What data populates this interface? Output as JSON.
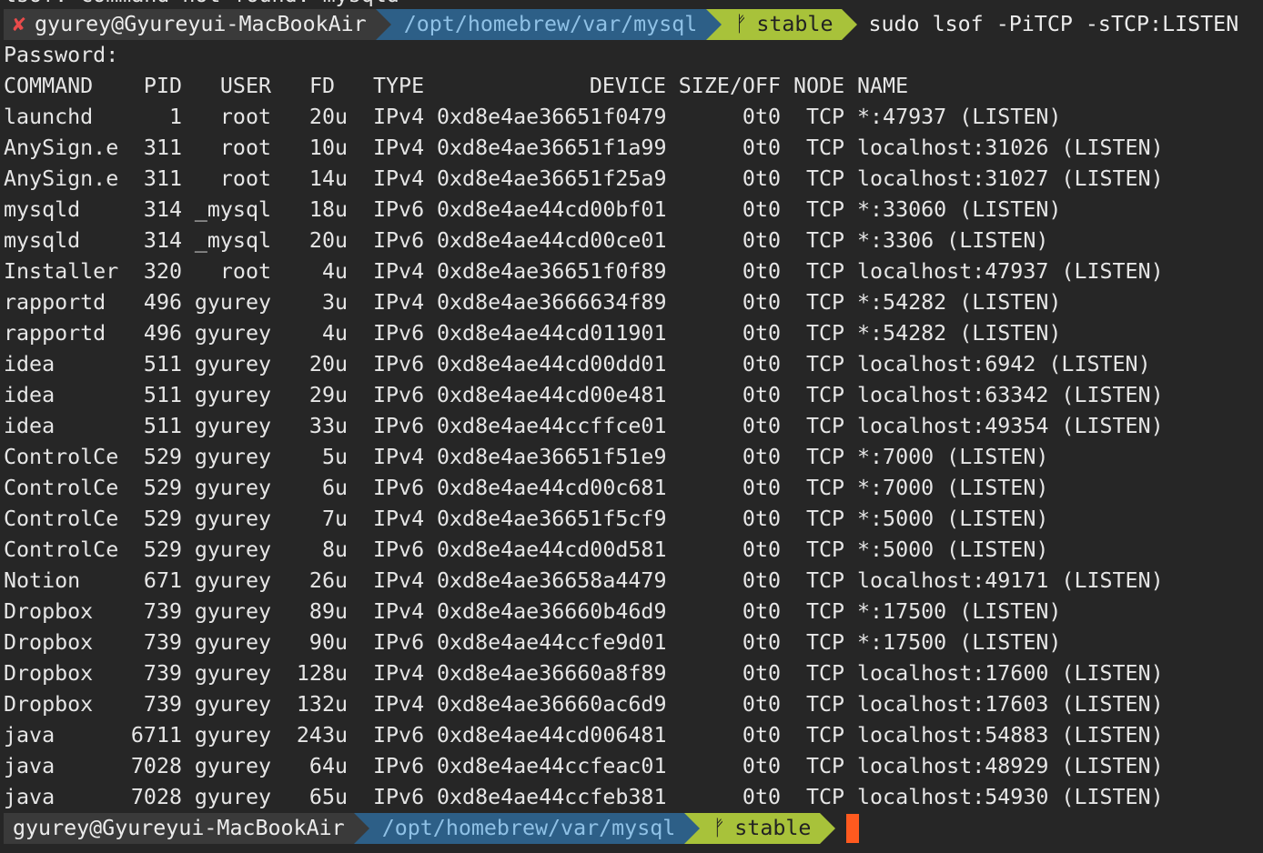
{
  "clipped_line": "lsof: command not found: mysqld",
  "prompt1": {
    "error_icon": "✘",
    "user_host": "gyurey@Gyureyui-MacBookAir",
    "path": "/opt/homebrew/var/mysql",
    "branch_icon": "ᚠ",
    "branch": "stable",
    "command": "sudo lsof -PiTCP -sTCP:LISTEN"
  },
  "password_line": "Password:",
  "headers": {
    "command": "COMMAND",
    "pid": "PID",
    "user": "USER",
    "fd": "FD",
    "type": "TYPE",
    "device": "DEVICE",
    "size_off": "SIZE/OFF",
    "node": "NODE",
    "name": "NAME"
  },
  "rows": [
    {
      "command": "launchd",
      "pid": "1",
      "user": "root",
      "fd": "20u",
      "type": "IPv4",
      "device": "0xd8e4ae36651f0479",
      "size_off": "0t0",
      "node": "TCP",
      "name": "*:47937 (LISTEN)"
    },
    {
      "command": "AnySign.e",
      "pid": "311",
      "user": "root",
      "fd": "10u",
      "type": "IPv4",
      "device": "0xd8e4ae36651f1a99",
      "size_off": "0t0",
      "node": "TCP",
      "name": "localhost:31026 (LISTEN)"
    },
    {
      "command": "AnySign.e",
      "pid": "311",
      "user": "root",
      "fd": "14u",
      "type": "IPv4",
      "device": "0xd8e4ae36651f25a9",
      "size_off": "0t0",
      "node": "TCP",
      "name": "localhost:31027 (LISTEN)"
    },
    {
      "command": "mysqld",
      "pid": "314",
      "user": "_mysql",
      "fd": "18u",
      "type": "IPv6",
      "device": "0xd8e4ae44cd00bf01",
      "size_off": "0t0",
      "node": "TCP",
      "name": "*:33060 (LISTEN)"
    },
    {
      "command": "mysqld",
      "pid": "314",
      "user": "_mysql",
      "fd": "20u",
      "type": "IPv6",
      "device": "0xd8e4ae44cd00ce01",
      "size_off": "0t0",
      "node": "TCP",
      "name": "*:3306 (LISTEN)"
    },
    {
      "command": "Installer",
      "pid": "320",
      "user": "root",
      "fd": "4u",
      "type": "IPv4",
      "device": "0xd8e4ae36651f0f89",
      "size_off": "0t0",
      "node": "TCP",
      "name": "localhost:47937 (LISTEN)"
    },
    {
      "command": "rapportd",
      "pid": "496",
      "user": "gyurey",
      "fd": "3u",
      "type": "IPv4",
      "device": "0xd8e4ae3666634f89",
      "size_off": "0t0",
      "node": "TCP",
      "name": "*:54282 (LISTEN)"
    },
    {
      "command": "rapportd",
      "pid": "496",
      "user": "gyurey",
      "fd": "4u",
      "type": "IPv6",
      "device": "0xd8e4ae44cd011901",
      "size_off": "0t0",
      "node": "TCP",
      "name": "*:54282 (LISTEN)"
    },
    {
      "command": "idea",
      "pid": "511",
      "user": "gyurey",
      "fd": "20u",
      "type": "IPv6",
      "device": "0xd8e4ae44cd00dd01",
      "size_off": "0t0",
      "node": "TCP",
      "name": "localhost:6942 (LISTEN)"
    },
    {
      "command": "idea",
      "pid": "511",
      "user": "gyurey",
      "fd": "29u",
      "type": "IPv6",
      "device": "0xd8e4ae44cd00e481",
      "size_off": "0t0",
      "node": "TCP",
      "name": "localhost:63342 (LISTEN)"
    },
    {
      "command": "idea",
      "pid": "511",
      "user": "gyurey",
      "fd": "33u",
      "type": "IPv6",
      "device": "0xd8e4ae44ccffce01",
      "size_off": "0t0",
      "node": "TCP",
      "name": "localhost:49354 (LISTEN)"
    },
    {
      "command": "ControlCe",
      "pid": "529",
      "user": "gyurey",
      "fd": "5u",
      "type": "IPv4",
      "device": "0xd8e4ae36651f51e9",
      "size_off": "0t0",
      "node": "TCP",
      "name": "*:7000 (LISTEN)"
    },
    {
      "command": "ControlCe",
      "pid": "529",
      "user": "gyurey",
      "fd": "6u",
      "type": "IPv6",
      "device": "0xd8e4ae44cd00c681",
      "size_off": "0t0",
      "node": "TCP",
      "name": "*:7000 (LISTEN)"
    },
    {
      "command": "ControlCe",
      "pid": "529",
      "user": "gyurey",
      "fd": "7u",
      "type": "IPv4",
      "device": "0xd8e4ae36651f5cf9",
      "size_off": "0t0",
      "node": "TCP",
      "name": "*:5000 (LISTEN)"
    },
    {
      "command": "ControlCe",
      "pid": "529",
      "user": "gyurey",
      "fd": "8u",
      "type": "IPv6",
      "device": "0xd8e4ae44cd00d581",
      "size_off": "0t0",
      "node": "TCP",
      "name": "*:5000 (LISTEN)"
    },
    {
      "command": "Notion",
      "pid": "671",
      "user": "gyurey",
      "fd": "26u",
      "type": "IPv4",
      "device": "0xd8e4ae36658a4479",
      "size_off": "0t0",
      "node": "TCP",
      "name": "localhost:49171 (LISTEN)"
    },
    {
      "command": "Dropbox",
      "pid": "739",
      "user": "gyurey",
      "fd": "89u",
      "type": "IPv4",
      "device": "0xd8e4ae36660b46d9",
      "size_off": "0t0",
      "node": "TCP",
      "name": "*:17500 (LISTEN)"
    },
    {
      "command": "Dropbox",
      "pid": "739",
      "user": "gyurey",
      "fd": "90u",
      "type": "IPv6",
      "device": "0xd8e4ae44ccfe9d01",
      "size_off": "0t0",
      "node": "TCP",
      "name": "*:17500 (LISTEN)"
    },
    {
      "command": "Dropbox",
      "pid": "739",
      "user": "gyurey",
      "fd": "128u",
      "type": "IPv4",
      "device": "0xd8e4ae36660a8f89",
      "size_off": "0t0",
      "node": "TCP",
      "name": "localhost:17600 (LISTEN)"
    },
    {
      "command": "Dropbox",
      "pid": "739",
      "user": "gyurey",
      "fd": "132u",
      "type": "IPv4",
      "device": "0xd8e4ae36660ac6d9",
      "size_off": "0t0",
      "node": "TCP",
      "name": "localhost:17603 (LISTEN)"
    },
    {
      "command": "java",
      "pid": "6711",
      "user": "gyurey",
      "fd": "243u",
      "type": "IPv6",
      "device": "0xd8e4ae44cd006481",
      "size_off": "0t0",
      "node": "TCP",
      "name": "localhost:54883 (LISTEN)"
    },
    {
      "command": "java",
      "pid": "7028",
      "user": "gyurey",
      "fd": "64u",
      "type": "IPv6",
      "device": "0xd8e4ae44ccfeac01",
      "size_off": "0t0",
      "node": "TCP",
      "name": "localhost:48929 (LISTEN)"
    },
    {
      "command": "java",
      "pid": "7028",
      "user": "gyurey",
      "fd": "65u",
      "type": "IPv6",
      "device": "0xd8e4ae44ccfeb381",
      "size_off": "0t0",
      "node": "TCP",
      "name": "localhost:54930 (LISTEN)"
    }
  ],
  "prompt2": {
    "user_host": "gyurey@Gyureyui-MacBookAir",
    "path": "/opt/homebrew/var/mysql",
    "branch_icon": "ᚠ",
    "branch": "stable"
  },
  "colors": {
    "background": "#262626",
    "text": "#e6e6e6",
    "user_segment": "#3a3a3a",
    "path_segment": "#2d5f87",
    "path_text": "#8fc1e6",
    "git_segment": "#a8c23a",
    "error_icon": "#e84b4b",
    "cursor": "#ff5a1f"
  }
}
